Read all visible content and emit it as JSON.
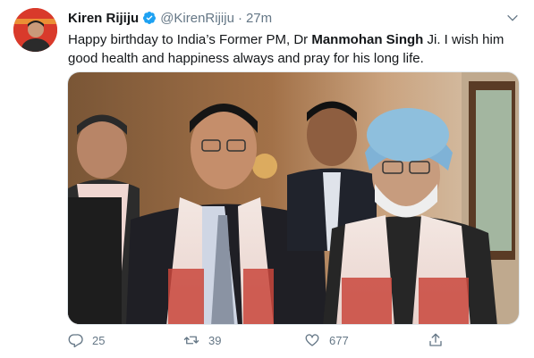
{
  "tweet": {
    "author_name": "Kiren Rijiju",
    "handle": "@KirenRijiju",
    "separator": "·",
    "time": "27m",
    "text_before": "Happy birthday to India’s Former PM, Dr ",
    "text_bold": "Manmohan Singh",
    "text_after": " Ji. I wish him good health and happiness always and pray for his long life."
  },
  "actions": {
    "replies": "25",
    "retweets": "39",
    "likes": "677"
  },
  "colors": {
    "verified": "#1da1f2",
    "secondary_text": "#657786",
    "avatar_bg": "#d93a2b"
  },
  "icons": [
    "verified-badge-icon",
    "chevron-down-icon",
    "reply-icon",
    "retweet-icon",
    "like-icon",
    "share-icon"
  ]
}
